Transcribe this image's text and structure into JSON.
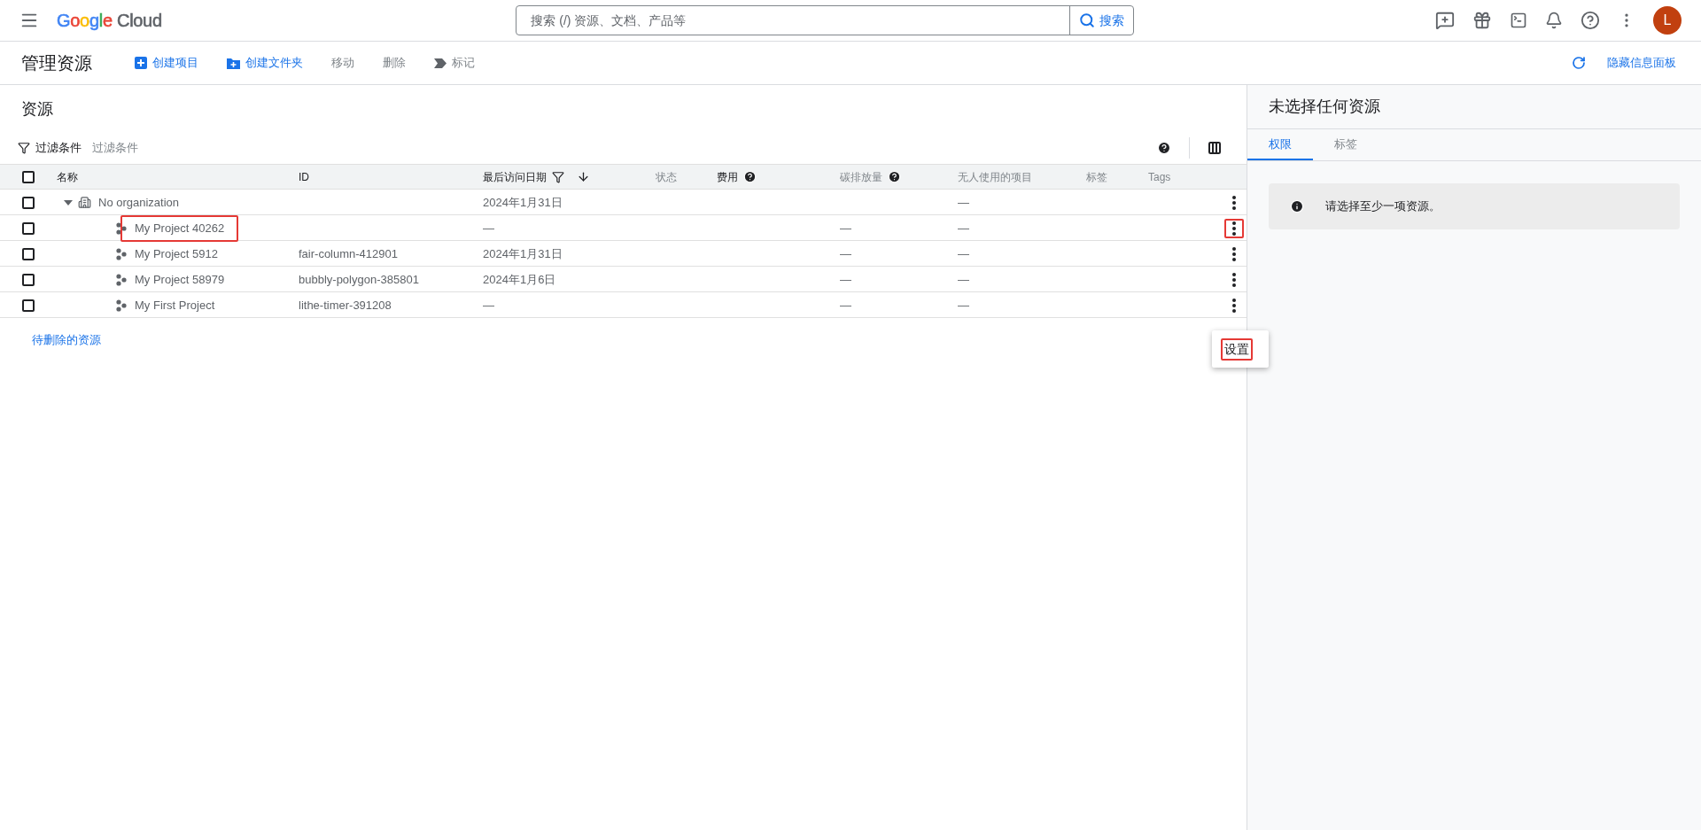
{
  "topbar": {
    "logo": [
      {
        "text": "G",
        "color": "#4285f4"
      },
      {
        "text": "o",
        "color": "#ea4335"
      },
      {
        "text": "o",
        "color": "#fbbc05"
      },
      {
        "text": "g",
        "color": "#4285f4"
      },
      {
        "text": "l",
        "color": "#34a853"
      },
      {
        "text": "e",
        "color": "#ea4335"
      },
      {
        "text": " Cloud",
        "color": "#5f6368"
      }
    ],
    "search": {
      "placeholder": "搜索 (/) 资源、文档、产品等",
      "button": "搜索"
    },
    "avatar": "L"
  },
  "toolbar": {
    "title": "管理资源",
    "actions": [
      {
        "label": "创建项目",
        "kind": "add",
        "disabled": false
      },
      {
        "label": "创建文件夹",
        "kind": "folder",
        "disabled": false
      },
      {
        "label": "移动",
        "kind": "plain",
        "disabled": true
      },
      {
        "label": "删除",
        "kind": "plain",
        "disabled": true
      },
      {
        "label": "标记",
        "kind": "tag",
        "disabled": true
      }
    ],
    "hide_panel": "隐藏信息面板"
  },
  "resources": {
    "title": "资源",
    "filter": {
      "label": "过滤条件",
      "placeholder": "过滤条件"
    },
    "columns": [
      {
        "label": "名称",
        "help": false,
        "sorted": false,
        "emphasized": true
      },
      {
        "label": "ID",
        "help": false,
        "sorted": false,
        "emphasized": true
      },
      {
        "label": "最后访问日期",
        "help": false,
        "sorted": true,
        "emphasized": true
      },
      {
        "label": "状态",
        "help": false,
        "sorted": false,
        "emphasized": false
      },
      {
        "label": "费用",
        "help": true,
        "sorted": false,
        "emphasized": true
      },
      {
        "label": "碳排放量",
        "help": true,
        "sorted": false,
        "emphasized": false
      },
      {
        "label": "无人使用的项目",
        "help": false,
        "sorted": false,
        "emphasized": false
      },
      {
        "label": "标签",
        "help": false,
        "sorted": false,
        "emphasized": false
      },
      {
        "label": "Tags",
        "help": false,
        "sorted": false,
        "emphasized": false
      }
    ],
    "all_checked": false,
    "rows": [
      {
        "kind": "organization",
        "expanded": true,
        "checked": false,
        "highlighted": false,
        "menu_highlighted": false,
        "cells": [
          "No organization",
          "",
          "2024年1月31日",
          "",
          "",
          "",
          "—",
          "",
          ""
        ],
        "children": [
          {
            "kind": "project",
            "checked": false,
            "highlighted": true,
            "menu_highlighted": true,
            "cells": [
              "My Project 40262",
              "",
              "—",
              "",
              "",
              "—",
              "—",
              "",
              ""
            ]
          },
          {
            "kind": "project",
            "checked": false,
            "highlighted": false,
            "menu_highlighted": false,
            "cells": [
              "My Project 5912",
              "fair-column-412901",
              "2024年1月31日",
              "",
              "",
              "—",
              "—",
              "",
              ""
            ]
          },
          {
            "kind": "project",
            "checked": false,
            "highlighted": false,
            "menu_highlighted": false,
            "cells": [
              "My Project 58979",
              "bubbly-polygon-385801",
              "2024年1月6日",
              "",
              "",
              "—",
              "—",
              "",
              ""
            ]
          },
          {
            "kind": "project",
            "checked": false,
            "highlighted": false,
            "menu_highlighted": false,
            "cells": [
              "My First Project",
              "lithe-timer-391208",
              "—",
              "",
              "",
              "—",
              "—",
              "",
              ""
            ]
          }
        ]
      }
    ],
    "pending_link": "待删除的资源",
    "menu": {
      "items": [
        {
          "label": "设置",
          "highlighted": true
        }
      ]
    }
  },
  "info_panel": {
    "title": "未选择任何资源",
    "tabs": [
      {
        "label": "权限",
        "selected": true
      },
      {
        "label": "标签",
        "selected": false
      }
    ],
    "message": "请选择至少一项资源。"
  }
}
